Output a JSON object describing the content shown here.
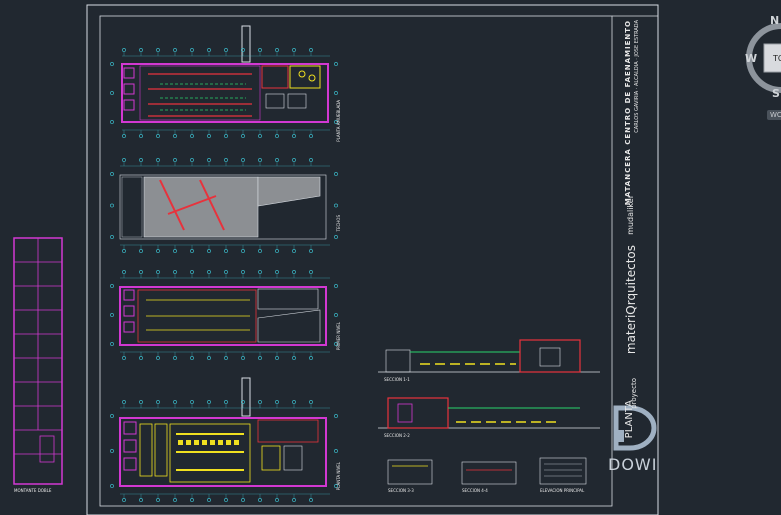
{
  "navigation": {
    "compass": {
      "north": "N",
      "west": "W",
      "south": "S",
      "view_label": "TO",
      "ucs_label": "WCS"
    }
  },
  "drawing": {
    "plan_labels": [
      "PLANTA AMUEBLADA",
      "TECHOS",
      "PRIMER NIVEL",
      "PLANTA NIVEL"
    ],
    "section_labels": [
      "SECCION 1-1",
      "SECCION 2-2",
      "SECCION 3-3",
      "SECCION 4-4",
      "ELEVACION PRINCIPAL"
    ],
    "small_plan_label": "MONTANTE DOBLE"
  },
  "title_block": {
    "project_title": "MATANCERA CENTRO DE FAENAMIENTO",
    "project_subtitle": "CARLOS GAVIRIA  ·  ALCALDIA  ·  JOSE ESTRADA",
    "designer": "mudaliker",
    "firm": "materiQrquitectos",
    "project_word": "proyecto",
    "planta_word": "PLANTA"
  },
  "watermark": {
    "text": "DOWI"
  },
  "colors": {
    "background": "#212830",
    "frame": "#d8dde3",
    "wall_magenta": "#d238d2",
    "accent_red": "#e8323c",
    "accent_yellow": "#f0e020",
    "accent_green": "#29d36b",
    "grid_cyan": "#3fd0e0",
    "hatch_gray": "#8c8f93"
  }
}
